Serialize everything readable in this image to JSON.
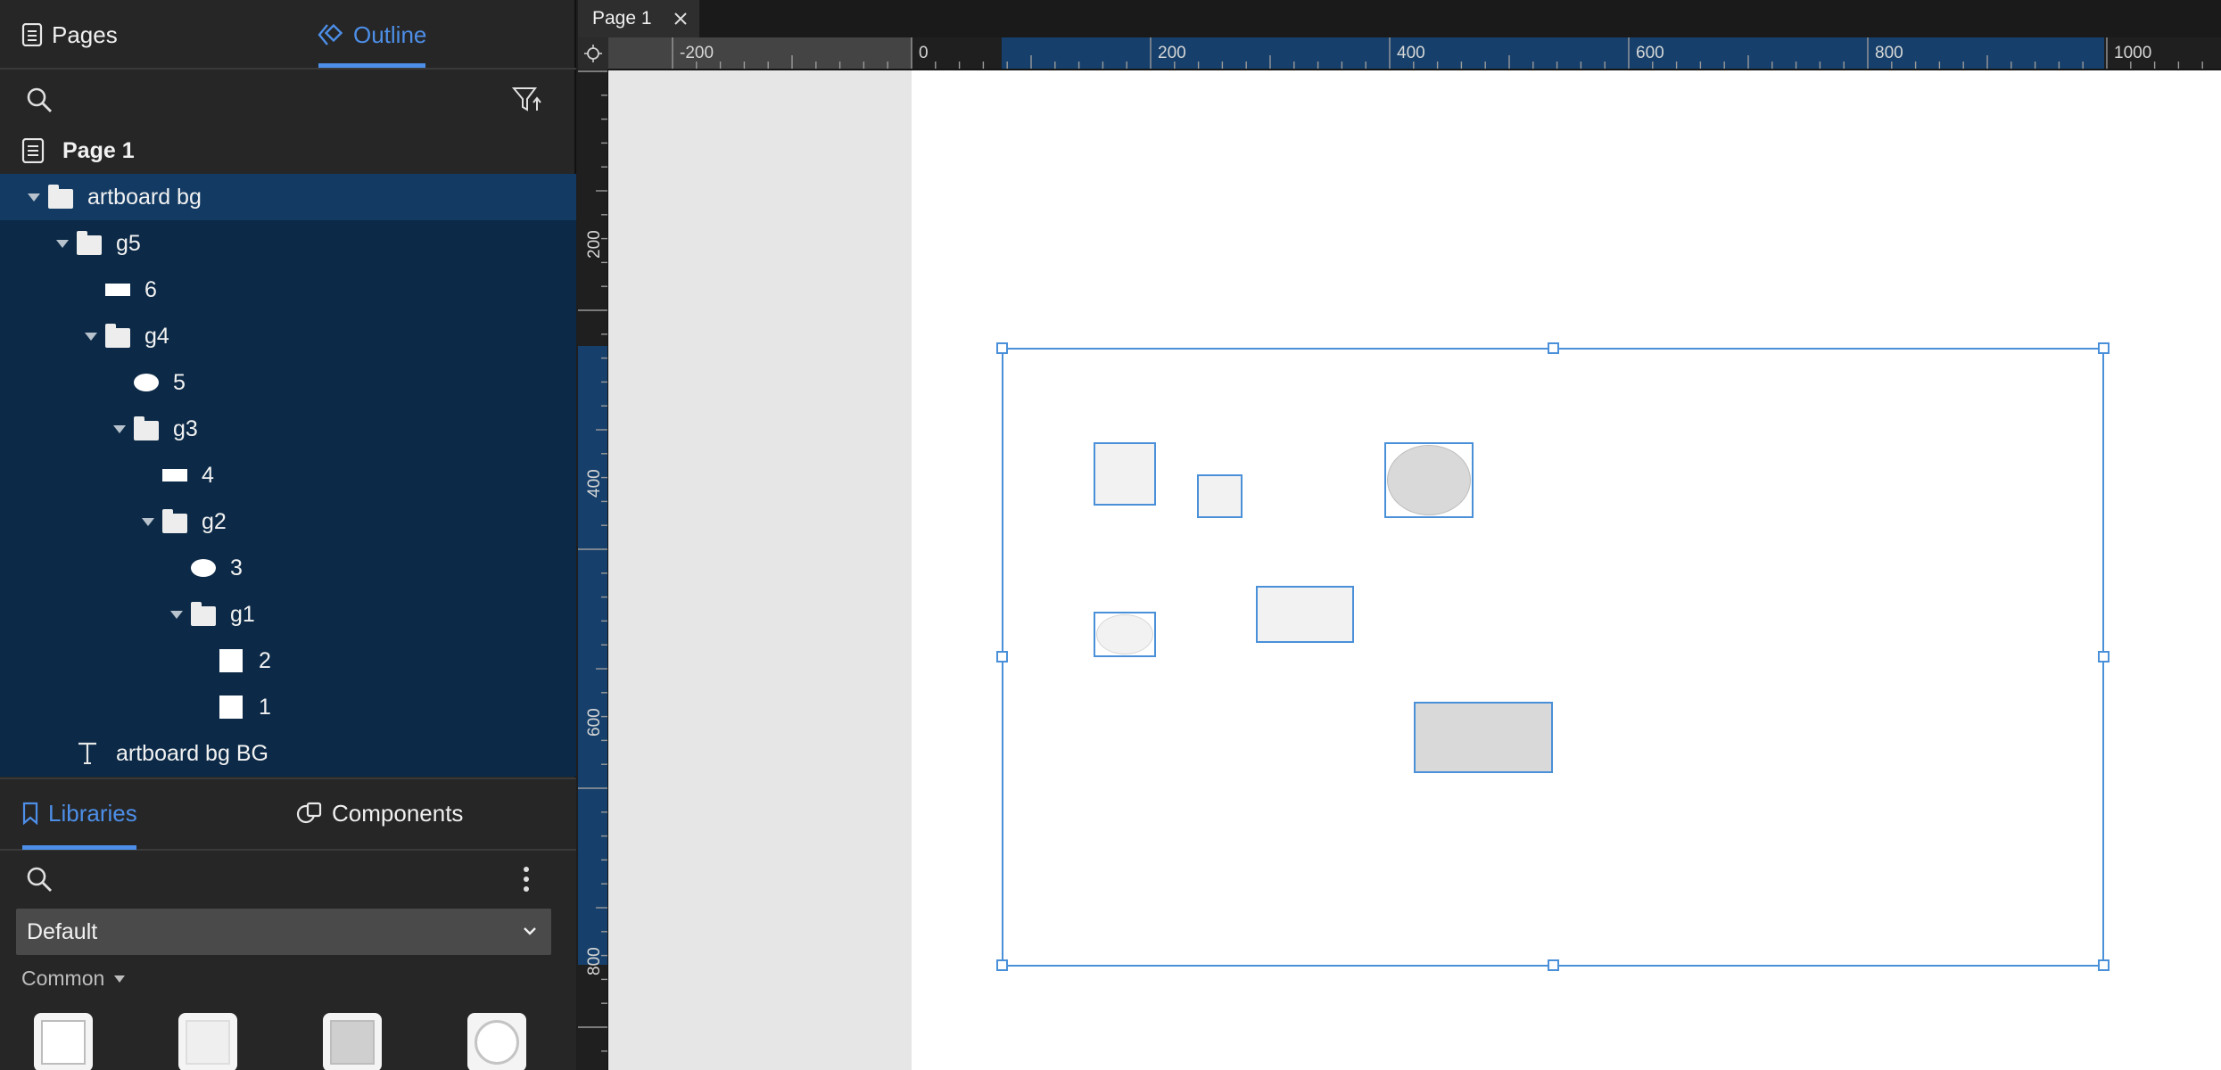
{
  "left_panel": {
    "tabs": {
      "pages": "Pages",
      "outline": "Outline"
    },
    "page_header": "Page 1",
    "tree": {
      "artboard": "artboard bg",
      "g5": "g5",
      "item6": "6",
      "g4": "g4",
      "item5": "5",
      "g3": "g3",
      "item4": "4",
      "g2": "g2",
      "item3": "3",
      "g1": "g1",
      "item2": "2",
      "item1": "1",
      "text_layer": "artboard bg BG"
    },
    "library_tabs": {
      "libraries": "Libraries",
      "components": "Components"
    },
    "library_select": "Default",
    "section_label": "Common"
  },
  "document": {
    "tab_title": "Page 1"
  },
  "rulers": {
    "horizontal": [
      "-200",
      "0",
      "200",
      "400",
      "600",
      "800",
      "1000"
    ],
    "vertical": [
      "200",
      "400",
      "600",
      "800"
    ]
  },
  "colors": {
    "accent": "#4d8fe8",
    "selection": "#123a63",
    "selection_child": "#0c2a47",
    "shape_fill": "#f2f2f2",
    "shape_dark_fill": "#d9d9d9",
    "frame_stroke": "#4a90d9"
  }
}
